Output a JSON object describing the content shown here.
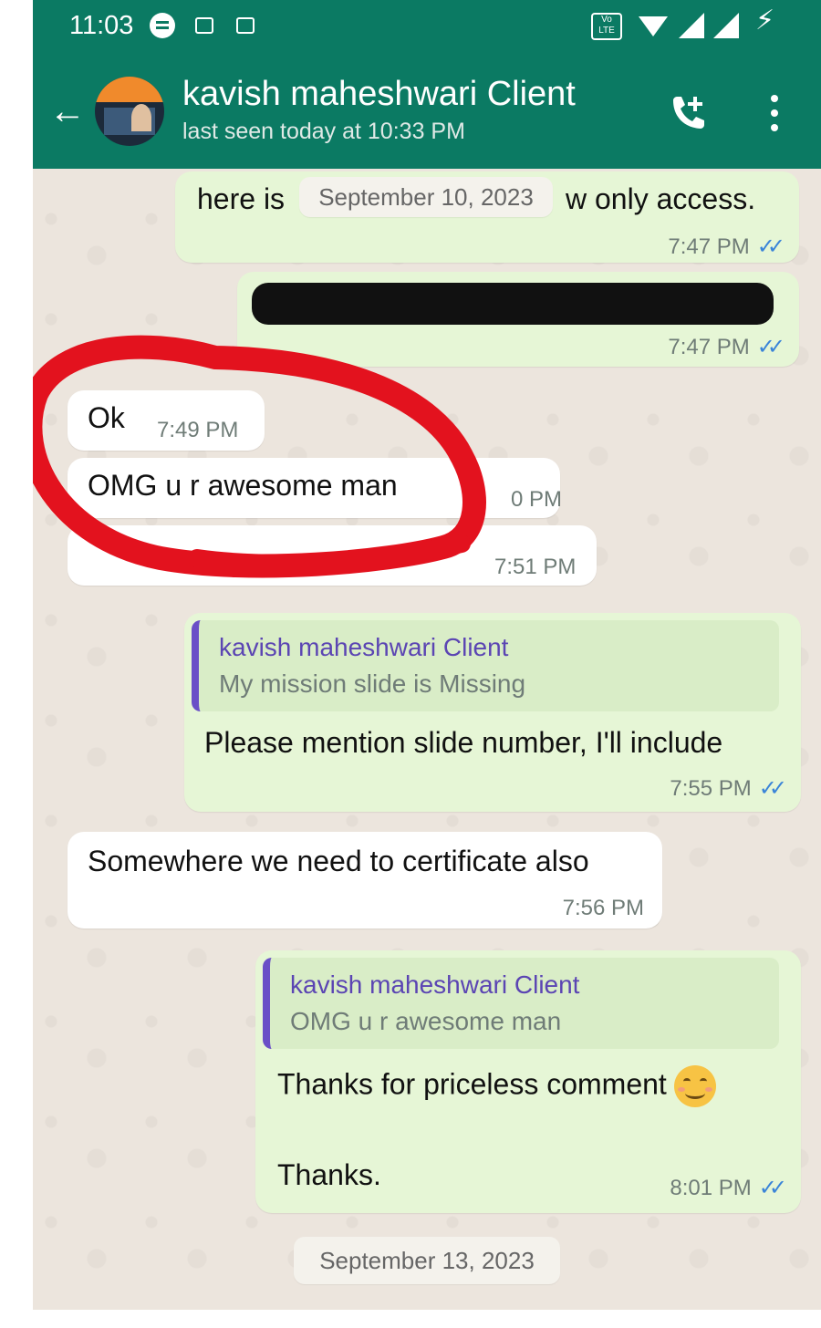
{
  "status_bar": {
    "time": "11:03",
    "volte": "Vo LTE"
  },
  "header": {
    "contact_name": "kavish maheshwari Client",
    "last_seen": "last seen today at 10:33 PM",
    "back_icon": "arrow-left-icon",
    "call_icon": "phone-add-icon",
    "menu_icon": "more-vertical-icon"
  },
  "colors": {
    "header_bg": "#0b7a63",
    "chat_bg": "#ece5dd",
    "outgoing_bubble": "#e6f6d6",
    "incoming_bubble": "#ffffff",
    "read_ticks": "#3a84d8",
    "quote_accent": "#6a4fc7",
    "annotation_red": "#e3121e"
  },
  "messages": [
    {
      "id": "m1",
      "direction": "out",
      "text_start": "here is",
      "text_end": "w only access.",
      "time": "7:47 PM",
      "ticks": "✓✓"
    },
    {
      "id": "m2",
      "direction": "out",
      "text": "",
      "redacted": true,
      "time": "7:47 PM",
      "ticks": "✓✓"
    },
    {
      "id": "m3",
      "direction": "in",
      "text": "Ok",
      "time": "7:49 PM"
    },
    {
      "id": "m4",
      "direction": "in",
      "text": "OMG u r awesome man",
      "time": "0 PM"
    },
    {
      "id": "m5",
      "direction": "in",
      "text": "",
      "obscured": true,
      "time": "7:51 PM"
    },
    {
      "id": "m6",
      "direction": "out",
      "reply_to_name": "kavish maheshwari Client",
      "reply_to_text": "My mission slide is Missing",
      "text": "Please mention slide number, I'll include",
      "time": "7:55 PM",
      "ticks": "✓✓"
    },
    {
      "id": "m7",
      "direction": "in",
      "text": "Somewhere we need to certificate also",
      "time": "7:56 PM"
    },
    {
      "id": "m8",
      "direction": "out",
      "reply_to_name": "kavish maheshwari Client",
      "reply_to_text": "OMG u r awesome man",
      "text_line1": "Thanks for priceless comment",
      "emoji": "smiling-face-icon",
      "text_line2": "Thanks.",
      "time": "8:01 PM",
      "ticks": "✓✓"
    }
  ],
  "date_chips": {
    "floating": "September 10, 2023",
    "bottom": "September 13, 2023"
  }
}
